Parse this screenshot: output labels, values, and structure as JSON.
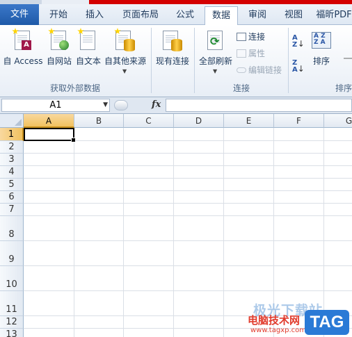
{
  "ribbon_tabs": [
    "文件",
    "开始",
    "插入",
    "页面布局",
    "公式",
    "数据",
    "审阅",
    "视图",
    "福昕PDF"
  ],
  "active_tab": "数据",
  "groups": {
    "external_data": {
      "label": "获取外部数据",
      "buttons": {
        "access": "自 Access",
        "web": "自网站",
        "text": "自文本",
        "other": "自其他来源"
      }
    },
    "existing": {
      "label": "现有连接"
    },
    "connections": {
      "label": "连接",
      "refresh_all": "全部刷新",
      "connections": "连接",
      "properties": "属性",
      "edit_links": "编辑链接"
    },
    "sort": {
      "label": "排序",
      "sort_button": "排序"
    }
  },
  "formula_bar": {
    "name_box": "A1",
    "fx": "fx",
    "formula": ""
  },
  "sheet": {
    "columns": [
      "A",
      "B",
      "C",
      "D",
      "E",
      "F",
      "G"
    ],
    "rows": [
      "1",
      "2",
      "3",
      "4",
      "5",
      "6",
      "7",
      "8",
      "9",
      "10",
      "11",
      "12",
      "13"
    ],
    "selected_cell": "A1"
  },
  "watermark": {
    "top": "极光下载站",
    "brand": "电脑技术网",
    "url": "www.tagxp.com",
    "tag": "TAG"
  },
  "colors": {
    "accent": "#2b579a",
    "selection": "#f1c15f",
    "file_tab": "#2d6bbf"
  }
}
